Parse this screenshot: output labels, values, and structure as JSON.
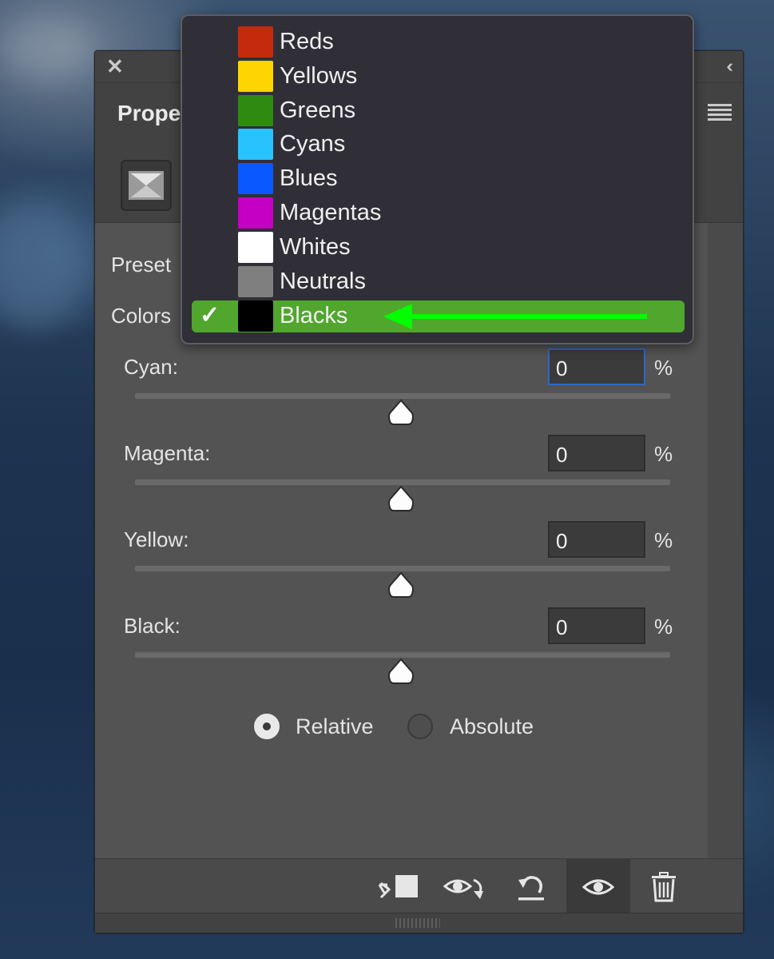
{
  "panel": {
    "title": "Prope",
    "preset_label": "Preset",
    "colors_label": "Colors"
  },
  "dropdown": {
    "items": [
      {
        "label": "Reds",
        "color": "#c52a0c"
      },
      {
        "label": "Yellows",
        "color": "#ffd500"
      },
      {
        "label": "Greens",
        "color": "#2e8a10"
      },
      {
        "label": "Cyans",
        "color": "#27c2ff"
      },
      {
        "label": "Blues",
        "color": "#0a58ff"
      },
      {
        "label": "Magentas",
        "color": "#c500c4"
      },
      {
        "label": "Whites",
        "color": "#ffffff"
      },
      {
        "label": "Neutrals",
        "color": "#7f7f7f"
      },
      {
        "label": "Blacks",
        "color": "#000000"
      }
    ],
    "selected": "Blacks",
    "check_glyph": "✓",
    "highlight_color": "#51a62d",
    "arrow_color": "#00ff00"
  },
  "sliders": [
    {
      "label": "Cyan:",
      "value": "0",
      "unit": "%",
      "level": 0
    },
    {
      "label": "Magenta:",
      "value": "0",
      "unit": "%",
      "level": 0
    },
    {
      "label": "Yellow:",
      "value": "0",
      "unit": "%",
      "level": 0
    },
    {
      "label": "Black:",
      "value": "0",
      "unit": "%",
      "level": 0
    }
  ],
  "method": {
    "relative_label": "Relative",
    "absolute_label": "Absolute",
    "selected": "Relative"
  },
  "footer": {
    "buttons": [
      "clip-to-layer-icon",
      "view-previous-state-icon",
      "reset-icon",
      "toggle-visibility-icon",
      "delete-icon"
    ]
  }
}
